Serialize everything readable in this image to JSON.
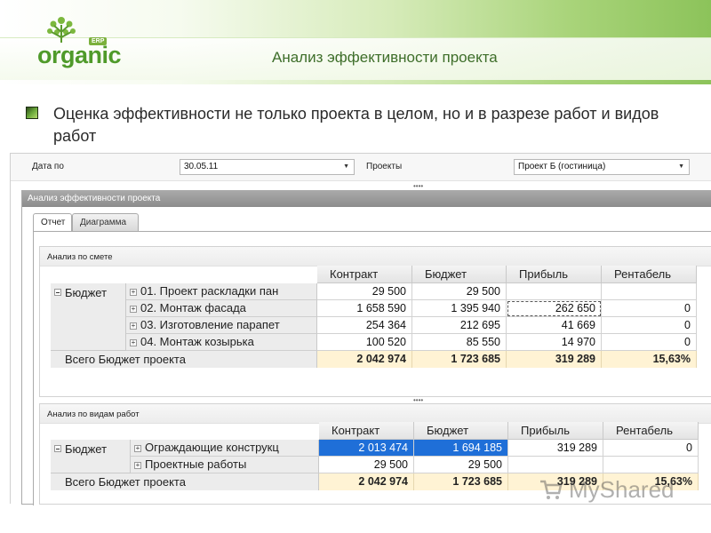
{
  "brand": {
    "logo_word": "organic",
    "logo_tag": "ERP"
  },
  "page": {
    "title": "Анализ эффективности проекта",
    "heading": "Оценка эффективности не только проекта в целом, но и в разрезе работ и видов работ"
  },
  "filters": {
    "date_label": "Дата по",
    "date_value": "30.05.11",
    "projects_label": "Проекты",
    "projects_value": "Проект Б (гостиница)"
  },
  "panel": {
    "title": "Анализ эффективности проекта",
    "tabs": [
      {
        "label": "Отчет",
        "active": true
      },
      {
        "label": "Диаграмма",
        "active": false
      }
    ]
  },
  "columns": [
    "Контракт",
    "Бюджет",
    "Прибыль",
    "Рентабель"
  ],
  "table_estimate": {
    "title": "Анализ по смете",
    "group": "Бюджет",
    "rows": [
      {
        "label": "01. Проект раскладки пан",
        "values": [
          "29 500",
          "29 500",
          "",
          ""
        ]
      },
      {
        "label": "02. Монтаж фасада",
        "values": [
          "1 658 590",
          "1 395 940",
          "262 650",
          "0"
        ]
      },
      {
        "label": "03. Изготовление парапет",
        "values": [
          "254 364",
          "212 695",
          "41 669",
          "0"
        ]
      },
      {
        "label": "04. Монтаж козырька",
        "values": [
          "100 520",
          "85 550",
          "14 970",
          "0"
        ]
      }
    ],
    "total_label": "Всего Бюджет проекта",
    "total_values": [
      "2 042 974",
      "1 723 685",
      "319 289",
      "15,63%"
    ]
  },
  "table_worktypes": {
    "title": "Анализ по видам работ",
    "group": "Бюджет",
    "rows": [
      {
        "label": "Ограждающие конструкц",
        "values": [
          "2 013 474",
          "1 694 185",
          "319 289",
          "0"
        ]
      },
      {
        "label": "Проектные работы",
        "values": [
          "29 500",
          "29 500",
          "",
          ""
        ]
      }
    ],
    "total_label": "Всего Бюджет проекта",
    "total_values": [
      "2 042 974",
      "1 723 685",
      "319 289",
      "15,63%"
    ]
  },
  "watermark": "MyShared",
  "colors": {
    "brand_green": "#4f9a2a",
    "selection_blue": "#1f6fd8",
    "total_bg": "#fff3d4"
  }
}
